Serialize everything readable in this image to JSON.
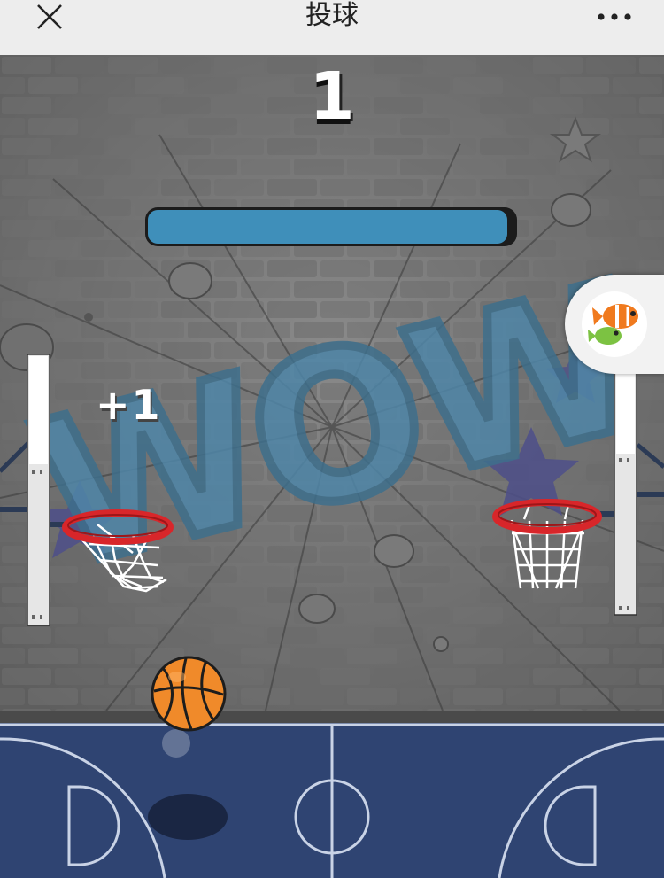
{
  "topbar": {
    "title": "投球",
    "close_icon": "close-x-icon",
    "more_icon": "more-dots-icon"
  },
  "game": {
    "score": "1",
    "bonus": "+1",
    "timer_level": 0.98,
    "wall_graffiti": "WOW",
    "colors": {
      "timer_fill": "#3f8fba",
      "court": "#2f4472",
      "ball": "#f08a2a",
      "rim": "#d8262a"
    },
    "icons": {
      "ball": "basketball-icon",
      "bubble": "clownfish-icon"
    }
  }
}
